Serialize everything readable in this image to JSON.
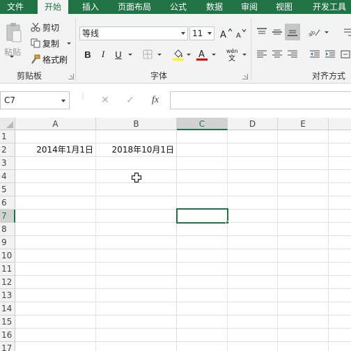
{
  "tabs": [
    {
      "label": "文件",
      "active": false
    },
    {
      "label": "开始",
      "active": true
    },
    {
      "label": "插入",
      "active": false
    },
    {
      "label": "页面布局",
      "active": false
    },
    {
      "label": "公式",
      "active": false
    },
    {
      "label": "数据",
      "active": false
    },
    {
      "label": "审阅",
      "active": false
    },
    {
      "label": "视图",
      "active": false
    },
    {
      "label": "开发工具",
      "active": false
    }
  ],
  "ribbon": {
    "clipboard": {
      "paste": "粘贴",
      "cut": "剪切",
      "copy": "复制",
      "format_painter": "格式刷",
      "group_label": "剪贴板"
    },
    "font": {
      "font_name": "等线",
      "font_size": "11",
      "bold": "B",
      "italic": "I",
      "underline": "U",
      "font_color_letter": "A",
      "phonetic": "wén",
      "group_label": "字体"
    },
    "alignment": {
      "group_label": "对齐方式"
    }
  },
  "formula_bar": {
    "name_box": "C7",
    "cancel": "✕",
    "enter": "✓",
    "fx": "fx",
    "value": ""
  },
  "sheet": {
    "columns": [
      "A",
      "B",
      "C",
      "D",
      "E"
    ],
    "rows": [
      "1",
      "2",
      "3",
      "4",
      "5",
      "6",
      "7",
      "8",
      "9",
      "10",
      "11",
      "12",
      "13",
      "14",
      "15",
      "16",
      "17"
    ],
    "selected_column": "C",
    "selected_row": "7",
    "cells": {
      "A2": "2014年1月1日",
      "B2": "2018年10月1日"
    }
  },
  "colors": {
    "accent": "#217346"
  }
}
